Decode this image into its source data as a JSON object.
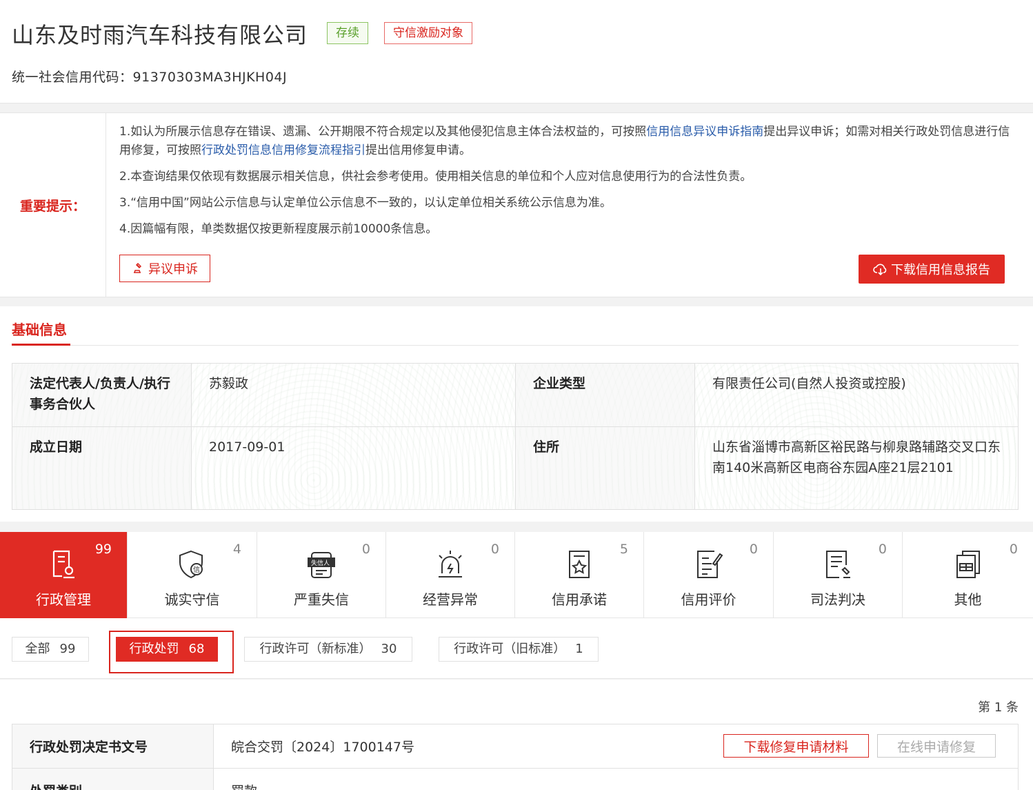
{
  "company": {
    "name": "山东及时雨汽车科技有限公司",
    "status_badge": "存续",
    "honor_badge": "守信激励对象",
    "credit_code_label": "统一社会信用代码：",
    "credit_code": "91370303MA3HJKH04J"
  },
  "notice": {
    "label": "重要提示：",
    "item1_a": "1.如认为所展示信息存在错误、遗漏、公开期限不符合规定以及其他侵犯信息主体合法权益的，可按照",
    "item1_link1": "信用信息异议申诉指南",
    "item1_b": "提出异议申诉；如需对相关行政处罚信息进行信用修复，可按照",
    "item1_link2": "行政处罚信息信用修复流程指引",
    "item1_c": "提出信用修复申请。",
    "item2": "2.本查询结果仅依现有数据展示相关信息，供社会参考使用。使用相关信息的单位和个人应对信息使用行为的合法性负责。",
    "item3": "3.“信用中国”网站公示信息与认定单位公示信息不一致的，以认定单位相关系统公示信息为准。",
    "item4": "4.因篇幅有限，单类数据仅按更新程度展示前10000条信息。",
    "objection_button": "异议申诉",
    "download_button": "下载信用信息报告"
  },
  "basic_info": {
    "title": "基础信息",
    "legal_rep_label": "法定代表人/负责人/执行事务合伙人",
    "legal_rep_value": "苏毅政",
    "company_type_label": "企业类型",
    "company_type_value": "有限责任公司(自然人投资或控股)",
    "founded_label": "成立日期",
    "founded_value": "2017-09-01",
    "address_label": "住所",
    "address_value": "山东省淄博市高新区裕民路与柳泉路辅路交叉口东南140米高新区电商谷东园A座21层2101"
  },
  "categories": [
    {
      "label": "行政管理",
      "count": "99",
      "icon": "admin-doc-icon",
      "active": true
    },
    {
      "label": "诚实守信",
      "count": "4",
      "icon": "shield-credit-icon",
      "active": false
    },
    {
      "label": "严重失信",
      "count": "0",
      "icon": "dishonest-person-icon",
      "active": false
    },
    {
      "label": "经营异常",
      "count": "0",
      "icon": "alarm-light-icon",
      "active": false
    },
    {
      "label": "信用承诺",
      "count": "5",
      "icon": "promise-doc-icon",
      "active": false
    },
    {
      "label": "信用评价",
      "count": "0",
      "icon": "evaluation-doc-icon",
      "active": false
    },
    {
      "label": "司法判决",
      "count": "0",
      "icon": "judgment-doc-icon",
      "active": false
    },
    {
      "label": "其他",
      "count": "0",
      "icon": "other-doc-icon",
      "active": false
    }
  ],
  "subtabs": [
    {
      "label": "全部",
      "count": "99"
    },
    {
      "label": "行政处罚",
      "count": "68"
    },
    {
      "label": "行政许可（新标准）",
      "count": "30"
    },
    {
      "label": "行政许可（旧标准）",
      "count": "1"
    }
  ],
  "records": {
    "page_text": "第 1 条",
    "row1_label": "行政处罚决定书文号",
    "row1_value": "皖合交罚〔2024〕1700147号",
    "row2_label": "处罚类别",
    "row2_value": "罚款",
    "download_repair_button": "下载修复申请材料",
    "online_repair_button": "在线申请修复"
  },
  "colors": {
    "accent": "#e02b24",
    "link": "#2a5caa",
    "status_green": "#5aa02c"
  }
}
